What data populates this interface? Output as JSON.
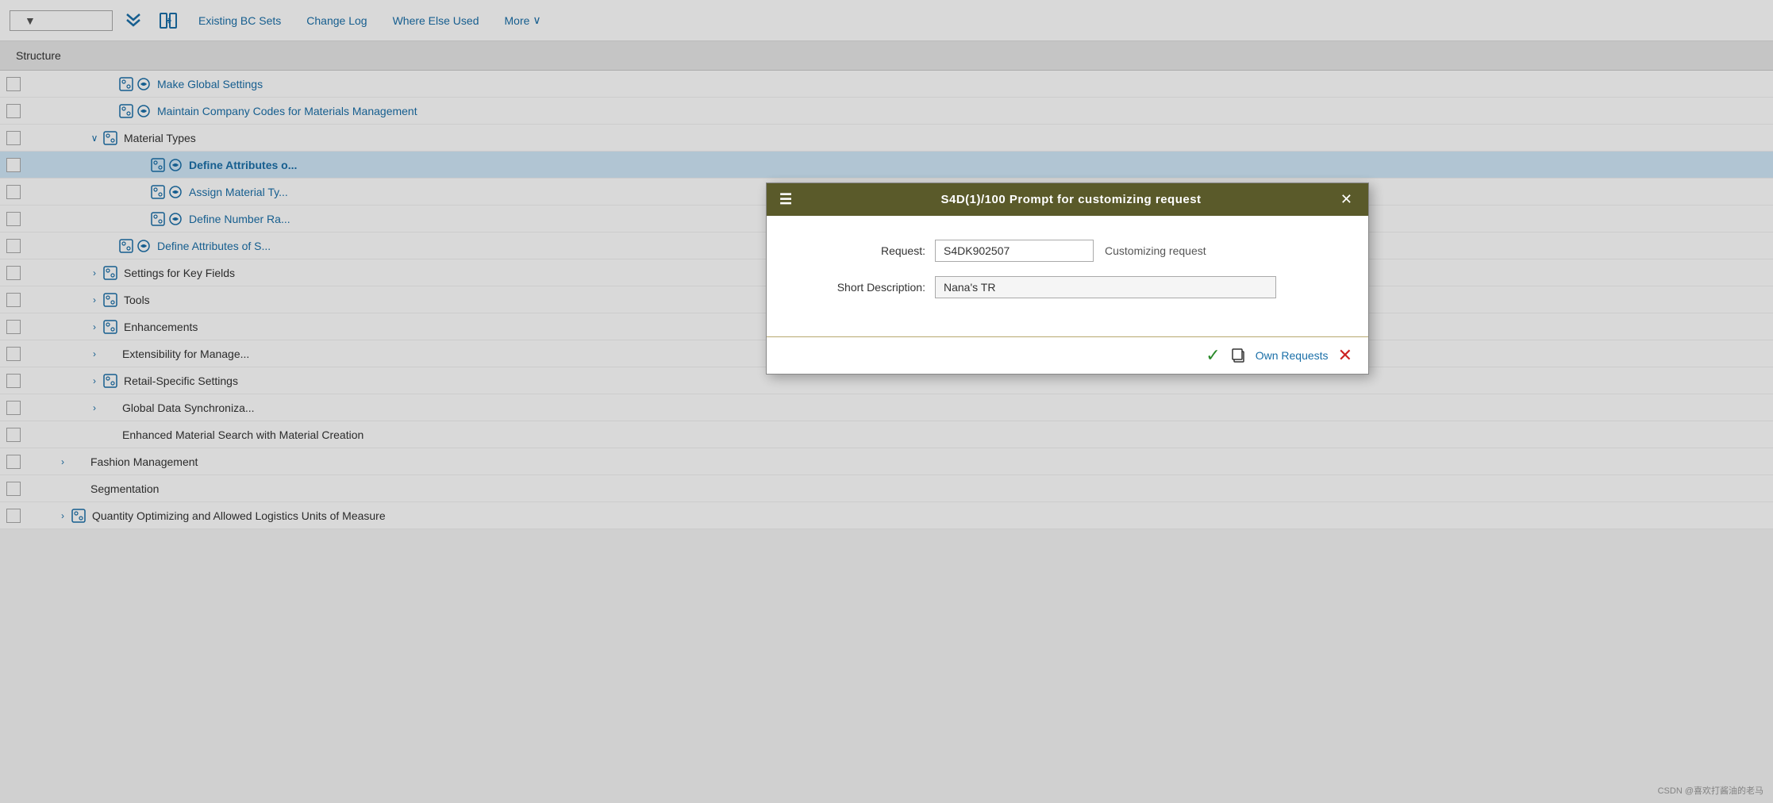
{
  "toolbar": {
    "select_placeholder": "",
    "chevron_down": "▼",
    "double_down_icon": "≫",
    "sync_icon": "⇄",
    "nav_links": [
      {
        "id": "existing-bc-sets",
        "label": "Existing BC Sets"
      },
      {
        "id": "change-log",
        "label": "Change Log"
      },
      {
        "id": "where-else-used",
        "label": "Where Else Used"
      },
      {
        "id": "more",
        "label": "More"
      }
    ],
    "more_chevron": "∨"
  },
  "structure_header": "Structure",
  "tree_rows": [
    {
      "id": "row-make-global",
      "indent": 120,
      "has_expander": false,
      "expander": "",
      "icons": [
        "config",
        "circle"
      ],
      "label": "Make Global Settings",
      "is_link": true
    },
    {
      "id": "row-maintain-company",
      "indent": 120,
      "has_expander": false,
      "expander": "",
      "icons": [
        "config",
        "circle"
      ],
      "label": "Maintain Company Codes for Materials Management",
      "is_link": true
    },
    {
      "id": "row-material-types",
      "indent": 80,
      "has_expander": true,
      "expander": "∨",
      "icons": [
        "config"
      ],
      "label": "Material Types",
      "is_link": false
    },
    {
      "id": "row-define-attributes",
      "indent": 160,
      "has_expander": false,
      "expander": "",
      "icons": [
        "config",
        "circle"
      ],
      "label": "Define Attributes o...",
      "is_link": true
    },
    {
      "id": "row-assign-material",
      "indent": 160,
      "has_expander": false,
      "expander": "",
      "icons": [
        "config",
        "circle"
      ],
      "label": "Assign Material Ty...",
      "is_link": true
    },
    {
      "id": "row-define-number",
      "indent": 160,
      "has_expander": false,
      "expander": "",
      "icons": [
        "config",
        "circle"
      ],
      "label": "Define Number Ra...",
      "is_link": true
    },
    {
      "id": "row-define-attributes-s",
      "indent": 120,
      "has_expander": false,
      "expander": "",
      "icons": [
        "config",
        "circle"
      ],
      "label": "Define Attributes of S...",
      "is_link": true
    },
    {
      "id": "row-settings-key",
      "indent": 80,
      "has_expander": true,
      "expander": ">",
      "icons": [
        "config"
      ],
      "label": "Settings for Key Fields",
      "is_link": false
    },
    {
      "id": "row-tools",
      "indent": 80,
      "has_expander": true,
      "expander": ">",
      "icons": [
        "config"
      ],
      "label": "Tools",
      "is_link": false
    },
    {
      "id": "row-enhancements",
      "indent": 80,
      "has_expander": true,
      "expander": ">",
      "icons": [
        "config"
      ],
      "label": "Enhancements",
      "is_link": false
    },
    {
      "id": "row-extensibility",
      "indent": 80,
      "has_expander": true,
      "expander": ">",
      "icons": [],
      "label": "Extensibility for Manage...",
      "is_link": false
    },
    {
      "id": "row-retail",
      "indent": 80,
      "has_expander": true,
      "expander": ">",
      "icons": [
        "config"
      ],
      "label": "Retail-Specific Settings",
      "is_link": false
    },
    {
      "id": "row-global-data",
      "indent": 80,
      "has_expander": true,
      "expander": ">",
      "icons": [],
      "label": "Global Data Synchroniza...",
      "is_link": false
    },
    {
      "id": "row-enhanced-material",
      "indent": 80,
      "has_expander": false,
      "expander": "",
      "icons": [],
      "label": "Enhanced Material Search with Material Creation",
      "is_link": false
    },
    {
      "id": "row-fashion",
      "indent": 40,
      "has_expander": true,
      "expander": ">",
      "icons": [],
      "label": "Fashion Management",
      "is_link": false
    },
    {
      "id": "row-segmentation",
      "indent": 40,
      "has_expander": false,
      "expander": "",
      "icons": [],
      "label": "Segmentation",
      "is_link": false
    },
    {
      "id": "row-quantity",
      "indent": 40,
      "has_expander": true,
      "expander": ">",
      "icons": [
        "config"
      ],
      "label": "Quantity Optimizing and Allowed Logistics Units of Measure",
      "is_link": false
    }
  ],
  "dialog": {
    "title": "S4D(1)/100 Prompt for customizing request",
    "menu_icon": "☰",
    "close_icon": "✕",
    "request_label": "Request:",
    "request_value": "S4DK902507",
    "request_note": "Customizing request",
    "short_desc_label": "Short Description:",
    "short_desc_value": "Nana's TR",
    "short_desc_placeholder": "Nana's TR",
    "btn_check": "✓",
    "btn_copy": "⧉",
    "btn_own_requests": "Own Requests",
    "btn_cancel": "✕"
  },
  "watermark": "CSDN @喜欢打酱油的老马"
}
